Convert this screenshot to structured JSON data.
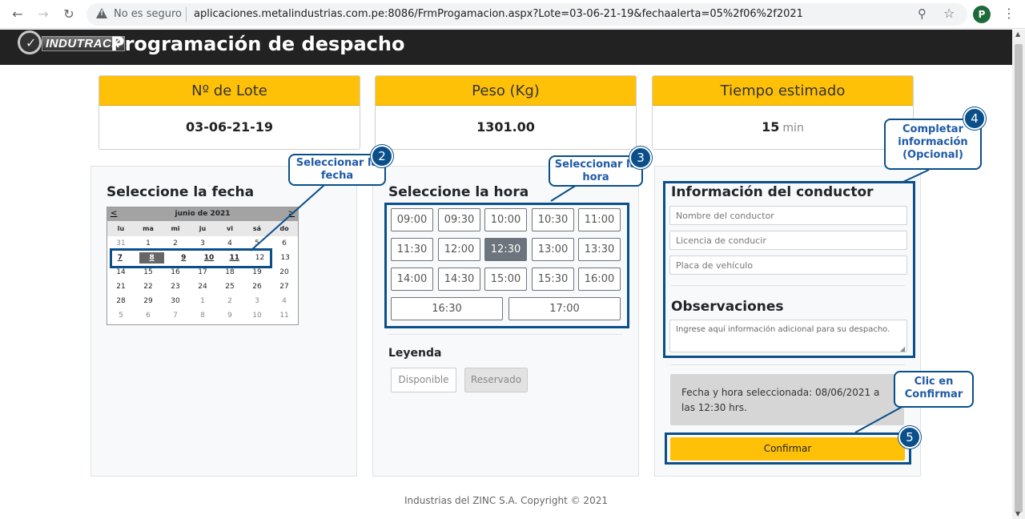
{
  "browser": {
    "insecure_label": "No es seguro",
    "url": "aplicaciones.metalindustrias.com.pe:8086/FrmProgamacion.aspx?Lote=03-06-21-19&fechaalerta=05%2f06%2f2021",
    "profile_initial": "P"
  },
  "header": {
    "logo_text": "INDUTRACK",
    "title": "Programación de despacho"
  },
  "cards": [
    {
      "label": "Nº de Lote",
      "value": "03-06-21-19",
      "unit": ""
    },
    {
      "label": "Peso (Kg)",
      "value": "1301.00",
      "unit": ""
    },
    {
      "label": "Tiempo estimado",
      "value": "15",
      "unit": "min"
    }
  ],
  "date_panel": {
    "title": "Seleccione la fecha",
    "prev": "<",
    "next": ">",
    "month": "junio de 2021",
    "dow": [
      "lu",
      "ma",
      "mi",
      "ju",
      "vi",
      "sá",
      "do"
    ],
    "weeks": [
      [
        "31",
        "1",
        "2",
        "3",
        "4",
        "5",
        "6"
      ],
      [
        "7",
        "8",
        "9",
        "10",
        "11",
        "12",
        "13"
      ],
      [
        "14",
        "15",
        "16",
        "17",
        "18",
        "19",
        "20"
      ],
      [
        "21",
        "22",
        "23",
        "24",
        "25",
        "26",
        "27"
      ],
      [
        "28",
        "29",
        "30",
        "1",
        "2",
        "3",
        "4"
      ],
      [
        "5",
        "6",
        "7",
        "8",
        "9",
        "10",
        "11"
      ]
    ],
    "selected": "8"
  },
  "time_panel": {
    "title": "Seleccione la hora",
    "slots": [
      "09:00",
      "09:30",
      "10:00",
      "10:30",
      "11:00",
      "11:30",
      "12:00",
      "12:30",
      "13:00",
      "13:30",
      "14:00",
      "14:30",
      "15:00",
      "15:30",
      "16:00",
      "16:30",
      "17:00"
    ],
    "selected": "12:30",
    "legend_title": "Leyenda",
    "legend_available": "Disponible",
    "legend_reserved": "Reservado"
  },
  "driver_panel": {
    "title": "Información del conductor",
    "name_placeholder": "Nombre del conductor",
    "license_placeholder": "Licencia de conducir",
    "plate_placeholder": "Placa de vehículo",
    "obs_title": "Observaciones",
    "obs_placeholder": "Ingrese aquí información adicional para su despacho.",
    "selection_text": "Fecha y hora seleccionada: 08/06/2021 a las 12:30 hrs.",
    "confirm_label": "Confirmar"
  },
  "footer": "Industrias del ZINC S.A. Copyright © 2021",
  "annotations": {
    "step2": {
      "num": "2",
      "text": "Seleccionar la fecha"
    },
    "step3": {
      "num": "3",
      "text": "Seleccionar la hora"
    },
    "step4": {
      "num": "4",
      "text": "Completar información (Opcional)"
    },
    "step5": {
      "num": "5",
      "text": "Clic en Confirmar"
    }
  },
  "colors": {
    "accent": "#ffc107",
    "annotation": "#0a4f8a",
    "header_bg": "#222222"
  }
}
